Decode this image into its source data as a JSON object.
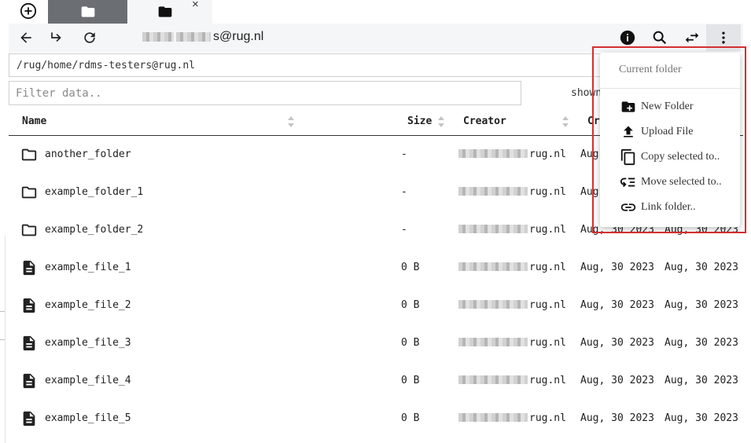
{
  "tabs": [
    {
      "icon": "folder-icon",
      "active": false
    },
    {
      "icon": "folder-icon",
      "active": true,
      "close": "×"
    }
  ],
  "toolbar": {
    "user_suffix": "s@rug.nl",
    "buttons": [
      "back-arrow-icon",
      "forward-arrow-icon",
      "refresh-icon",
      "info-icon",
      "search-icon",
      "swap-icon",
      "more-vert-icon"
    ]
  },
  "path": "/rug/home/rdms-testers@rug.nl",
  "filter": {
    "placeholder": "Filter data..",
    "value": ""
  },
  "shown_label": "shown",
  "table": {
    "headers": {
      "name": "Name",
      "size": "Size",
      "creator": "Creator",
      "created": "Cr"
    },
    "rows": [
      {
        "type": "folder",
        "name": "another_folder",
        "size": "-",
        "creator": "rug.nl",
        "created": "Aug",
        "modified": ""
      },
      {
        "type": "folder",
        "name": "example_folder_1",
        "size": "-",
        "creator": "rug.nl",
        "created": "Aug",
        "modified": ""
      },
      {
        "type": "folder",
        "name": "example_folder_2",
        "size": "-",
        "creator": "rug.nl",
        "created": "Aug, 30 2023",
        "modified": "Aug, 30 2023"
      },
      {
        "type": "file",
        "name": "example_file_1",
        "size": "0 B",
        "creator": "rug.nl",
        "created": "Aug, 30 2023",
        "modified": "Aug, 30 2023"
      },
      {
        "type": "file",
        "name": "example_file_2",
        "size": "0 B",
        "creator": "rug.nl",
        "created": "Aug, 30 2023",
        "modified": "Aug, 30 2023"
      },
      {
        "type": "file",
        "name": "example_file_3",
        "size": "0 B",
        "creator": "rug.nl",
        "created": "Aug, 30 2023",
        "modified": "Aug, 30 2023"
      },
      {
        "type": "file",
        "name": "example_file_4",
        "size": "0 B",
        "creator": "rug.nl",
        "created": "Aug, 30 2023",
        "modified": "Aug, 30 2023"
      },
      {
        "type": "file",
        "name": "example_file_5",
        "size": "0 B",
        "creator": "rug.nl",
        "created": "Aug, 30 2023",
        "modified": "Aug, 30 2023"
      }
    ]
  },
  "menu": {
    "header": "Current folder",
    "items": [
      {
        "label": "New Folder",
        "icon": "new-folder-icon"
      },
      {
        "label": "Upload File",
        "icon": "upload-icon"
      },
      {
        "label": "Copy selected to..",
        "icon": "copy-icon"
      },
      {
        "label": "Move selected to..",
        "icon": "move-icon"
      },
      {
        "label": "Link folder..",
        "icon": "link-icon"
      }
    ]
  },
  "colors": {
    "highlight": "#d32f2f",
    "active_tab": "#6b6e73",
    "toolbar_bg": "#f5f6f7"
  }
}
